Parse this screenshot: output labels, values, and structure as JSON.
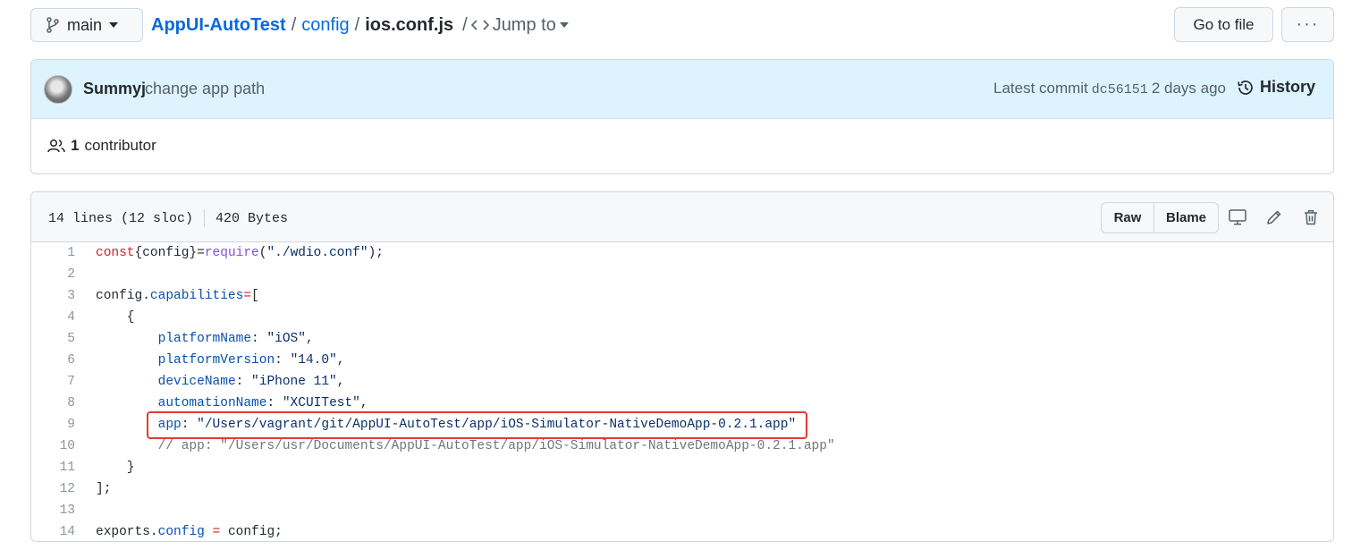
{
  "header": {
    "branch": "main",
    "repo": "AppUI-AutoTest",
    "sep1": "/",
    "folder": "config",
    "sep2": "/",
    "file": "ios.conf.js",
    "sep3": "/",
    "jump_to": "Jump to",
    "go_to_file": "Go to file",
    "more": "···"
  },
  "commit": {
    "author": "Summyj",
    "message": "change app path",
    "latest_label": "Latest commit",
    "sha": "dc56151",
    "age": "2 days ago",
    "history": "History",
    "contributor_count": "1",
    "contributor_label": "contributor"
  },
  "file": {
    "lines": "14 lines (12 sloc)",
    "size": "420 Bytes",
    "raw": "Raw",
    "blame": "Blame",
    "code_lines": [
      "const{config}=require(\"./wdio.conf\");",
      "",
      "config.capabilities=[",
      "    {",
      "        platformName: \"iOS\",",
      "        platformVersion: \"14.0\",",
      "        deviceName: \"iPhone 11\",",
      "        automationName: \"XCUITest\",",
      "        app: \"/Users/vagrant/git/AppUI-AutoTest/app/iOS-Simulator-NativeDemoApp-0.2.1.app\"",
      "        // app: \"/Users/usr/Documents/AppUI-AutoTest/app/iOS-Simulator-NativeDemoApp-0.2.1.app\"",
      "    }",
      "];",
      "",
      "exports.config = config;"
    ],
    "highlighted_line": 9
  },
  "icons": {
    "branch": "git-branch-icon",
    "caret": "caret-down-icon",
    "code": "code-icon",
    "history": "history-clock-icon",
    "people": "people-icon",
    "desktop": "desktop-icon",
    "pencil": "pencil-icon",
    "trash": "trash-icon"
  },
  "colors": {
    "link": "#0969da",
    "commit_bg": "#ddf4ff",
    "highlight_border": "#e03c31"
  }
}
